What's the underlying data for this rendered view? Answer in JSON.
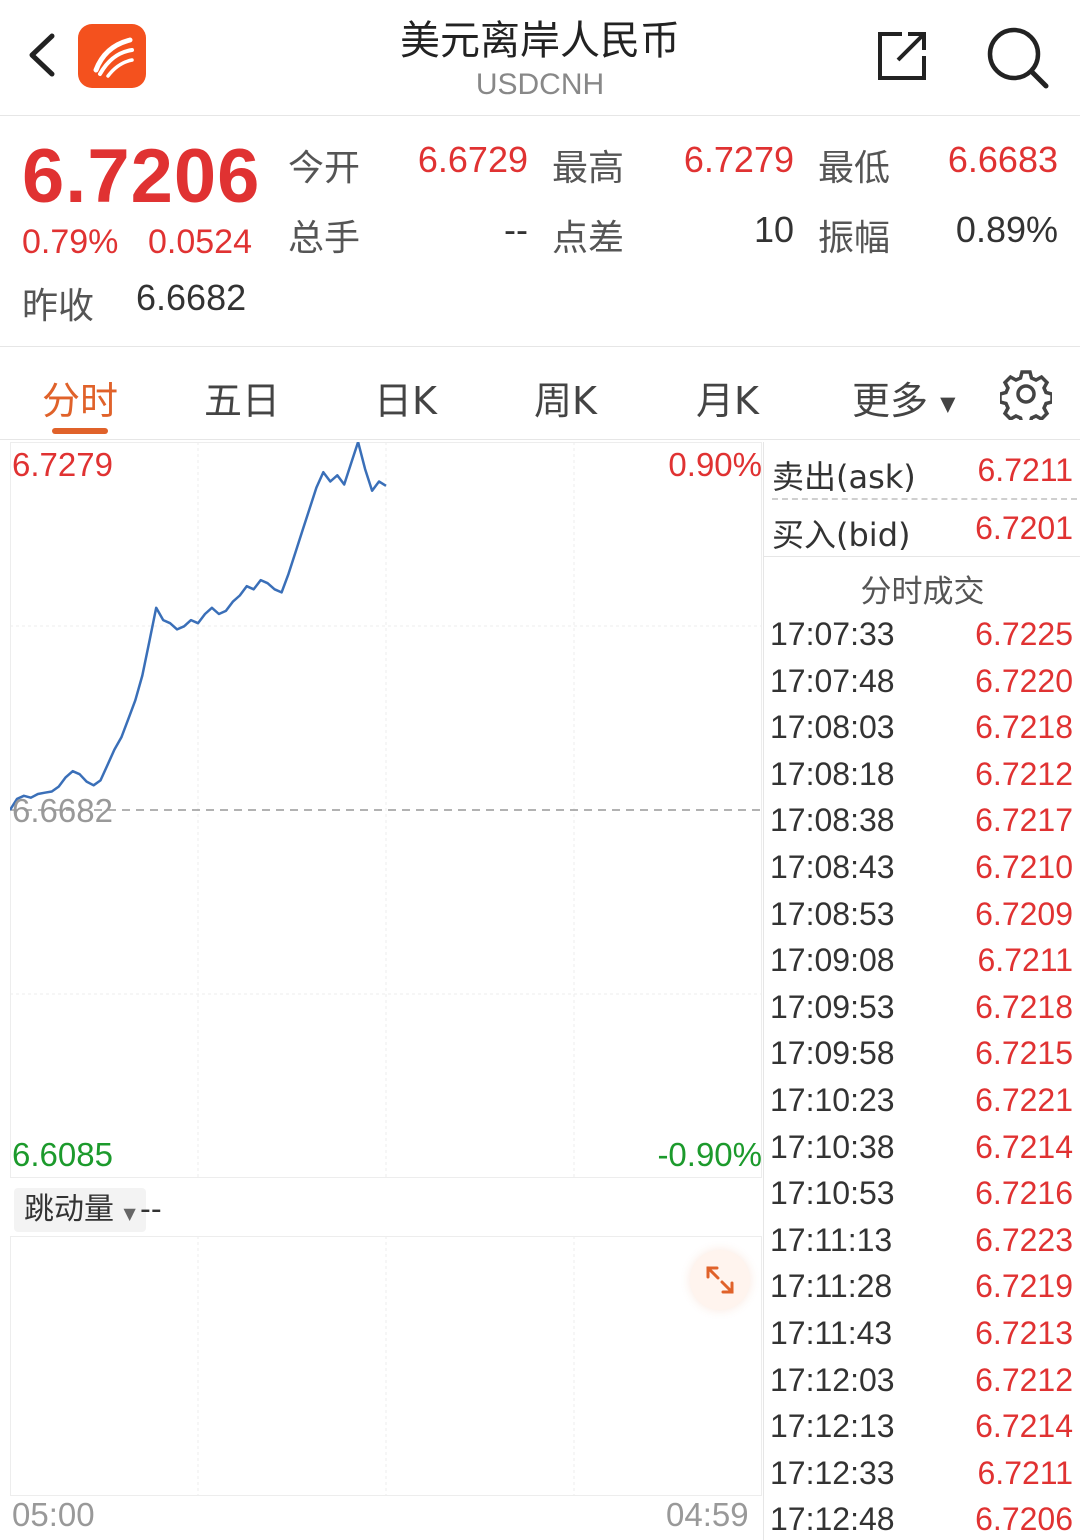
{
  "header": {
    "title": "美元离岸人民币",
    "subtitle": "USDCNH"
  },
  "quote": {
    "price": "6.7206",
    "change_pct": "0.79%",
    "change": "0.0524",
    "prev_close_label": "昨收",
    "prev_close": "6.6682",
    "stats": [
      {
        "label": "今开",
        "value": "6.6729",
        "color": "#e03232"
      },
      {
        "label": "最高",
        "value": "6.7279",
        "color": "#e03232"
      },
      {
        "label": "最低",
        "value": "6.6683",
        "color": "#e03232"
      },
      {
        "label": "总手",
        "value": "--",
        "color": "#333333"
      },
      {
        "label": "点差",
        "value": "10",
        "color": "#333333"
      },
      {
        "label": "振幅",
        "value": "0.89%",
        "color": "#333333"
      }
    ]
  },
  "tabs": {
    "items": [
      "分时",
      "五日",
      "日K",
      "周K",
      "月K",
      "更多"
    ],
    "active": "分时"
  },
  "chart": {
    "top_price": "6.7279",
    "top_pct": "0.90%",
    "baseline_price": "6.6682",
    "bottom_price": "6.6085",
    "bottom_pct": "-0.90%",
    "time_start": "05:00",
    "time_end": "04:59",
    "volume_selector": "跳动量",
    "volume_value": "--"
  },
  "chart_data": {
    "type": "line",
    "x": [
      "05:00",
      "04:59"
    ],
    "ylim": [
      6.6085,
      6.7279
    ],
    "baseline": 6.6682,
    "series": [
      {
        "values": [
          6.6682,
          6.67,
          6.6705,
          6.6702,
          6.6708,
          6.671,
          6.6712,
          6.672,
          6.6735,
          6.6745,
          6.674,
          6.6728,
          6.6722,
          6.673,
          6.6755,
          6.678,
          6.68,
          6.683,
          6.686,
          6.69,
          6.6955,
          6.701,
          6.699,
          6.6985,
          6.6975,
          6.698,
          6.699,
          6.6985,
          6.7,
          6.701,
          6.7,
          6.7005,
          6.702,
          6.703,
          6.7045,
          6.704,
          6.7055,
          6.705,
          6.704,
          6.7035,
          6.7065,
          6.71,
          6.7135,
          6.717,
          6.7205,
          6.723,
          6.7215,
          6.7225,
          6.721,
          6.7245,
          6.7279,
          6.7235,
          6.72,
          6.7215,
          6.7208
        ],
        "color": "#3a6fb8"
      }
    ]
  },
  "orderbook": {
    "ask_label": "卖出(ask)",
    "ask": "6.7211",
    "bid_label": "买入(bid)",
    "bid": "6.7201",
    "trades_title": "分时成交"
  },
  "trades": [
    {
      "time": "17:07:33",
      "price": "6.7225"
    },
    {
      "time": "17:07:48",
      "price": "6.7220"
    },
    {
      "time": "17:08:03",
      "price": "6.7218"
    },
    {
      "time": "17:08:18",
      "price": "6.7212"
    },
    {
      "time": "17:08:38",
      "price": "6.7217"
    },
    {
      "time": "17:08:43",
      "price": "6.7210"
    },
    {
      "time": "17:08:53",
      "price": "6.7209"
    },
    {
      "time": "17:09:08",
      "price": "6.7211"
    },
    {
      "time": "17:09:53",
      "price": "6.7218"
    },
    {
      "time": "17:09:58",
      "price": "6.7215"
    },
    {
      "time": "17:10:23",
      "price": "6.7221"
    },
    {
      "time": "17:10:38",
      "price": "6.7214"
    },
    {
      "time": "17:10:53",
      "price": "6.7216"
    },
    {
      "time": "17:11:13",
      "price": "6.7223"
    },
    {
      "time": "17:11:28",
      "price": "6.7219"
    },
    {
      "time": "17:11:43",
      "price": "6.7213"
    },
    {
      "time": "17:12:03",
      "price": "6.7212"
    },
    {
      "time": "17:12:13",
      "price": "6.7214"
    },
    {
      "time": "17:12:33",
      "price": "6.7211"
    },
    {
      "time": "17:12:48",
      "price": "6.7206"
    }
  ],
  "icons": {
    "back": "chevron-left-icon",
    "logo": "app-logo-icon",
    "share": "share-icon",
    "search": "search-icon",
    "settings": "gear-icon",
    "expand": "expand-icon"
  }
}
